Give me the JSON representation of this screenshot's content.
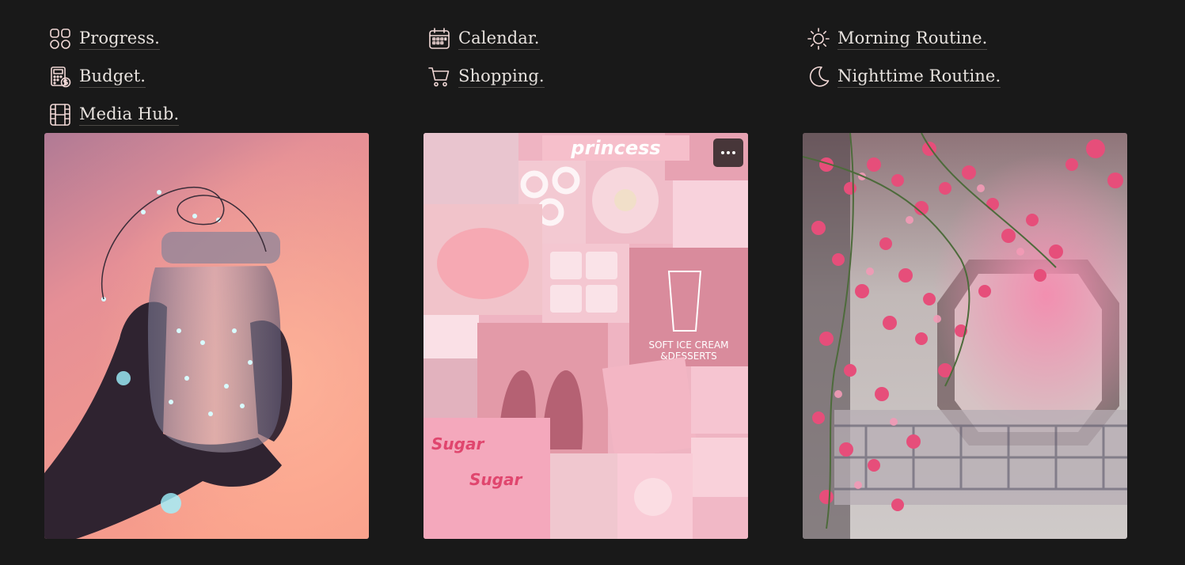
{
  "links": {
    "progress": {
      "label": "Progress.",
      "icon": "grid-icon"
    },
    "budget": {
      "label": "Budget.",
      "icon": "calculator-icon"
    },
    "media_hub": {
      "label": "Media Hub.",
      "icon": "film-icon"
    },
    "calendar": {
      "label": "Calendar.",
      "icon": "calendar-icon"
    },
    "shopping": {
      "label": "Shopping.",
      "icon": "cart-icon"
    },
    "morning_routine": {
      "label": "Morning Routine.",
      "icon": "sun-icon"
    },
    "nighttime_routine": {
      "label": "Nighttime Routine.",
      "icon": "moon-icon"
    }
  },
  "gallery": {
    "collage_banner": "princess",
    "more_button_icon": "more-horizontal-icon"
  },
  "colors": {
    "background": "#191919",
    "text": "#e7e2de",
    "icon": "#f1d8d6",
    "accent_pink": "#f6bfcb"
  }
}
